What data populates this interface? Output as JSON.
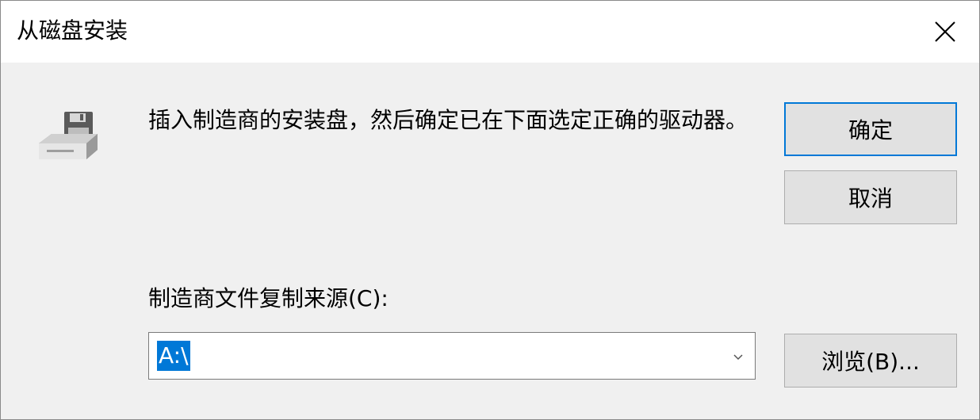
{
  "window": {
    "title": "从磁盘安装",
    "close_icon": "close-icon"
  },
  "icon": "floppy-disk-drive-icon",
  "message": "插入制造商的安装盘，然后确定已在下面选定正确的驱动器。",
  "buttons": {
    "ok": "确定",
    "cancel": "取消",
    "browse": "浏览(B)..."
  },
  "source": {
    "label": "制造商文件复制来源(C):",
    "value": "A:\\"
  },
  "colors": {
    "accent": "#0078d7",
    "dialog_bg": "#f0f0f0",
    "button_bg": "#e1e1e1"
  }
}
